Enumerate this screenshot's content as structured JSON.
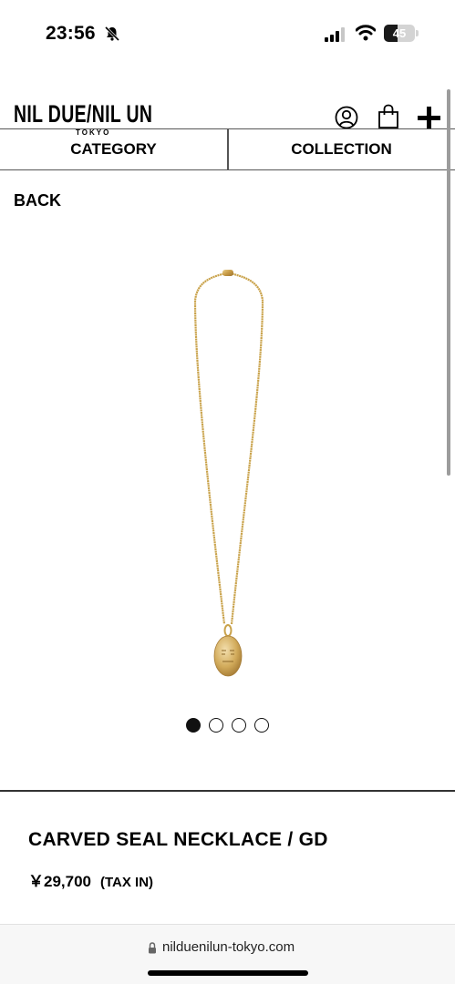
{
  "status_bar": {
    "time": "23:56",
    "battery_level": "45",
    "battery_fraction": 0.45,
    "icons": [
      "bell-muted-icon",
      "signal-icon",
      "wifi-icon",
      "battery-icon"
    ]
  },
  "header": {
    "brand_name": "NIL DUE/NIL UN",
    "brand_sub": "TOKYO",
    "icons": [
      "account-icon",
      "shopping-bag-icon",
      "plus-icon"
    ]
  },
  "nav": {
    "category": "CATEGORY",
    "collection": "COLLECTION"
  },
  "back_label": "BACK",
  "carousel": {
    "total": 4,
    "active_index": 0
  },
  "product": {
    "title": "CARVED SEAL NECKLACE / GD",
    "price": "￥29,700",
    "tax": "(TAX IN)"
  },
  "browser": {
    "url": "nilduenilun-tokyo.com"
  },
  "colors": {
    "gold": "#c9a24a",
    "text": "#000000",
    "background": "#ffffff"
  }
}
